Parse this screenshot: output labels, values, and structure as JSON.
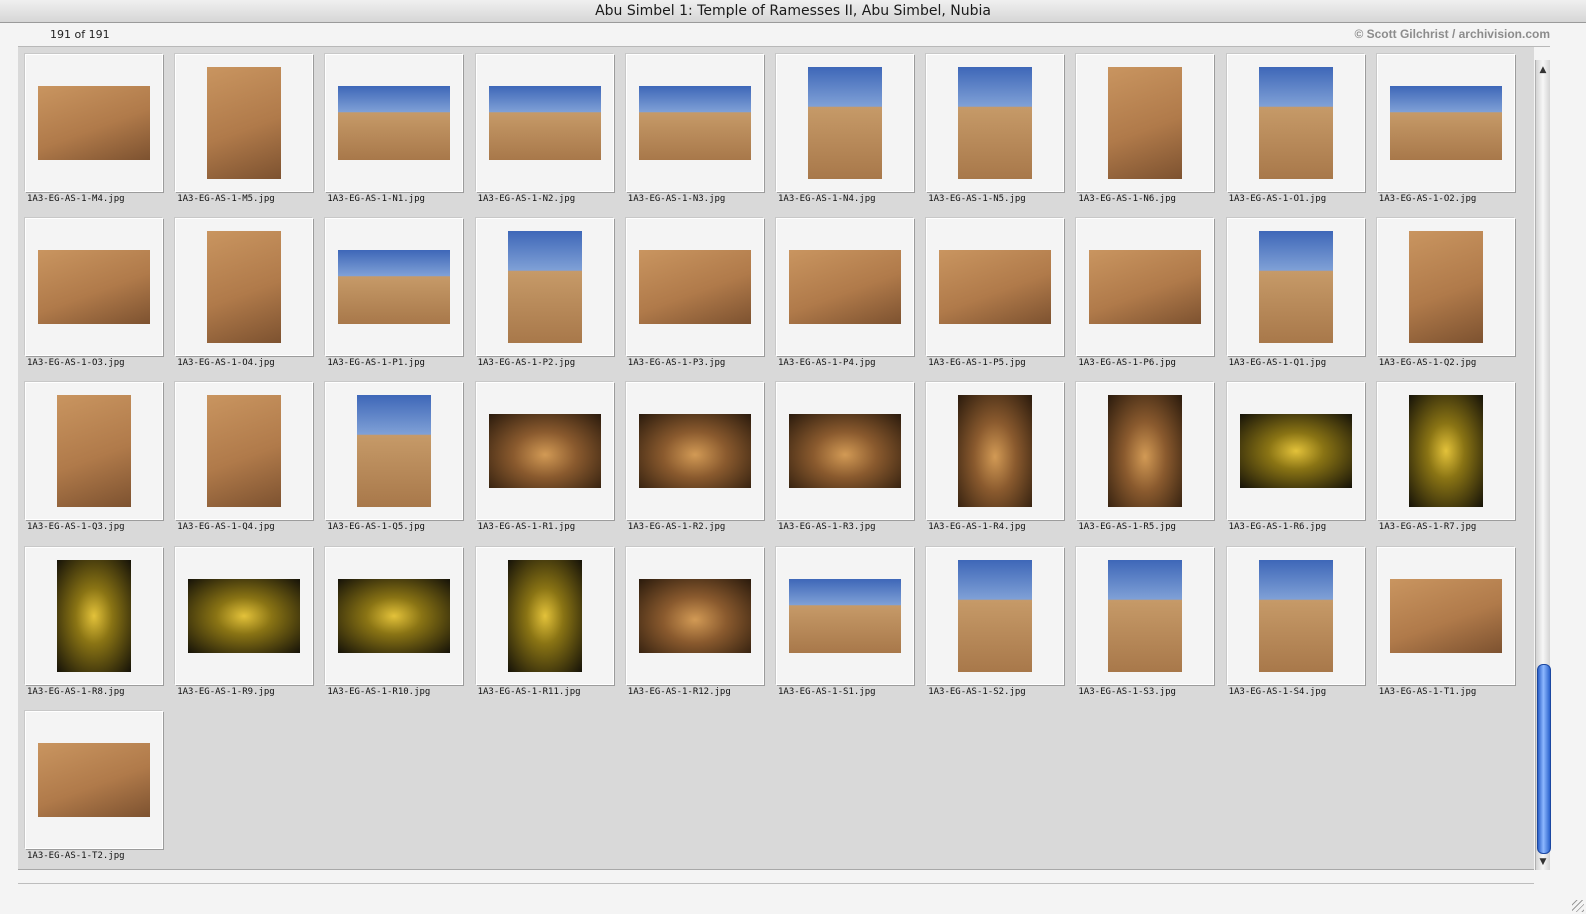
{
  "window": {
    "title": "Abu Simbel 1: Temple of Ramesses II, Abu Simbel, Nubia"
  },
  "info": {
    "count": "191 of 191",
    "copyright": "© Scott Gilchrist / archivision.com"
  },
  "thumbnails": [
    {
      "name": "1A3-EG-AS-1-M4.jpg",
      "orientation": "landscape",
      "tone": "sandstone"
    },
    {
      "name": "1A3-EG-AS-1-M5.jpg",
      "orientation": "portrait",
      "tone": "sandstone"
    },
    {
      "name": "1A3-EG-AS-1-N1.jpg",
      "orientation": "landscape",
      "tone": "sky-sand"
    },
    {
      "name": "1A3-EG-AS-1-N2.jpg",
      "orientation": "landscape",
      "tone": "sky-sand"
    },
    {
      "name": "1A3-EG-AS-1-N3.jpg",
      "orientation": "landscape",
      "tone": "sky-sand"
    },
    {
      "name": "1A3-EG-AS-1-N4.jpg",
      "orientation": "portrait",
      "tone": "sky-sand"
    },
    {
      "name": "1A3-EG-AS-1-N5.jpg",
      "orientation": "portrait",
      "tone": "sky-sand"
    },
    {
      "name": "1A3-EG-AS-1-N6.jpg",
      "orientation": "portrait",
      "tone": "sandstone"
    },
    {
      "name": "1A3-EG-AS-1-O1.jpg",
      "orientation": "portrait",
      "tone": "sky-sand"
    },
    {
      "name": "1A3-EG-AS-1-O2.jpg",
      "orientation": "landscape",
      "tone": "sky-sand"
    },
    {
      "name": "1A3-EG-AS-1-O3.jpg",
      "orientation": "landscape",
      "tone": "sandstone"
    },
    {
      "name": "1A3-EG-AS-1-O4.jpg",
      "orientation": "portrait",
      "tone": "sandstone"
    },
    {
      "name": "1A3-EG-AS-1-P1.jpg",
      "orientation": "landscape",
      "tone": "sky-sand"
    },
    {
      "name": "1A3-EG-AS-1-P2.jpg",
      "orientation": "portrait",
      "tone": "sky-sand"
    },
    {
      "name": "1A3-EG-AS-1-P3.jpg",
      "orientation": "landscape",
      "tone": "sandstone"
    },
    {
      "name": "1A3-EG-AS-1-P4.jpg",
      "orientation": "landscape",
      "tone": "sandstone"
    },
    {
      "name": "1A3-EG-AS-1-P5.jpg",
      "orientation": "landscape",
      "tone": "sandstone"
    },
    {
      "name": "1A3-EG-AS-1-P6.jpg",
      "orientation": "landscape",
      "tone": "sandstone"
    },
    {
      "name": "1A3-EG-AS-1-Q1.jpg",
      "orientation": "portrait",
      "tone": "sky-sand"
    },
    {
      "name": "1A3-EG-AS-1-Q2.jpg",
      "orientation": "portrait",
      "tone": "sandstone"
    },
    {
      "name": "1A3-EG-AS-1-Q3.jpg",
      "orientation": "portrait",
      "tone": "sandstone"
    },
    {
      "name": "1A3-EG-AS-1-Q4.jpg",
      "orientation": "portrait",
      "tone": "sandstone"
    },
    {
      "name": "1A3-EG-AS-1-Q5.jpg",
      "orientation": "portrait",
      "tone": "sky-sand"
    },
    {
      "name": "1A3-EG-AS-1-R1.jpg",
      "orientation": "landscape",
      "tone": "interior"
    },
    {
      "name": "1A3-EG-AS-1-R2.jpg",
      "orientation": "landscape",
      "tone": "interior"
    },
    {
      "name": "1A3-EG-AS-1-R3.jpg",
      "orientation": "landscape",
      "tone": "interior"
    },
    {
      "name": "1A3-EG-AS-1-R4.jpg",
      "orientation": "portrait",
      "tone": "interior"
    },
    {
      "name": "1A3-EG-AS-1-R5.jpg",
      "orientation": "portrait",
      "tone": "interior"
    },
    {
      "name": "1A3-EG-AS-1-R6.jpg",
      "orientation": "landscape",
      "tone": "lit"
    },
    {
      "name": "1A3-EG-AS-1-R7.jpg",
      "orientation": "portrait",
      "tone": "lit"
    },
    {
      "name": "1A3-EG-AS-1-R8.jpg",
      "orientation": "portrait",
      "tone": "lit"
    },
    {
      "name": "1A3-EG-AS-1-R9.jpg",
      "orientation": "landscape",
      "tone": "lit"
    },
    {
      "name": "1A3-EG-AS-1-R10.jpg",
      "orientation": "landscape",
      "tone": "lit"
    },
    {
      "name": "1A3-EG-AS-1-R11.jpg",
      "orientation": "portrait",
      "tone": "lit"
    },
    {
      "name": "1A3-EG-AS-1-R12.jpg",
      "orientation": "landscape",
      "tone": "interior"
    },
    {
      "name": "1A3-EG-AS-1-S1.jpg",
      "orientation": "landscape",
      "tone": "sky-sand"
    },
    {
      "name": "1A3-EG-AS-1-S2.jpg",
      "orientation": "portrait",
      "tone": "sky-sand"
    },
    {
      "name": "1A3-EG-AS-1-S3.jpg",
      "orientation": "portrait",
      "tone": "sky-sand"
    },
    {
      "name": "1A3-EG-AS-1-S4.jpg",
      "orientation": "portrait",
      "tone": "sky-sand"
    },
    {
      "name": "1A3-EG-AS-1-T1.jpg",
      "orientation": "landscape",
      "tone": "sandstone"
    },
    {
      "name": "1A3-EG-AS-1-T2.jpg",
      "orientation": "landscape",
      "tone": "sandstone"
    }
  ],
  "tones": {
    "sandstone": "#b07a4a",
    "sky-sand": "#5a7fc0",
    "interior": "#5a3a20",
    "lit": "#1e1a08"
  }
}
